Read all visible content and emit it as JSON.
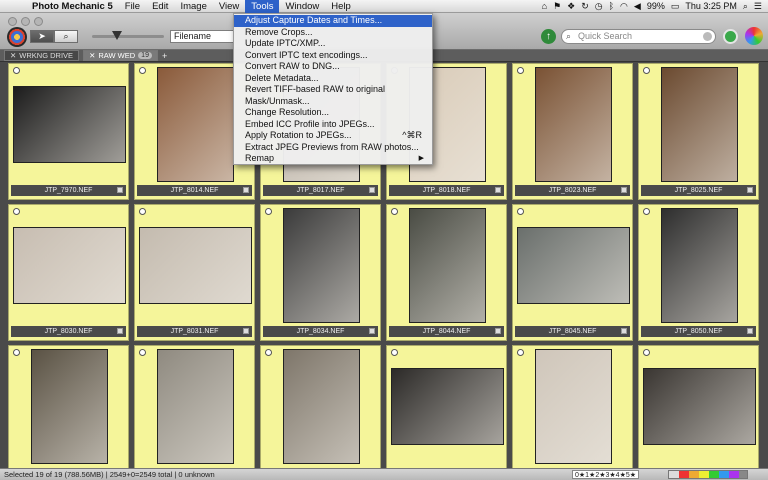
{
  "menubar": {
    "app": "Photo Mechanic 5",
    "items": [
      "File",
      "Edit",
      "Image",
      "View",
      "Tools",
      "Window",
      "Help"
    ],
    "battery": "99%",
    "clock": "Thu 3:25 PM"
  },
  "toolbar": {
    "sort_field": "Filename",
    "search_placeholder": "Quick Search"
  },
  "tabs": [
    {
      "label": "WRKNG DRIVE"
    },
    {
      "label": "RAW WED",
      "count": "19"
    }
  ],
  "tools_menu": {
    "items": [
      {
        "label": "Adjust Capture Dates and Times...",
        "highlight": true
      },
      {
        "label": "Remove Crops..."
      },
      {
        "label": "Update IPTC/XMP..."
      },
      {
        "label": "Convert IPTC text encodings..."
      },
      {
        "label": "Convert RAW to DNG..."
      },
      {
        "label": "Delete Metadata..."
      },
      {
        "label": "Revert TIFF-based RAW to original"
      },
      {
        "label": "Mask/Unmask..."
      },
      {
        "label": "Change Resolution..."
      },
      {
        "label": "Embed ICC Profile into JPEGs..."
      },
      {
        "label": "Apply Rotation to JPEGs...",
        "shortcut": "^⌘R"
      },
      {
        "label": "Extract JPEG Previews from RAW photos..."
      },
      {
        "label": "Remap",
        "submenu": true
      }
    ]
  },
  "thumbnails": [
    {
      "file": "JTP_7970.NEF",
      "color": "#1c1c1c"
    },
    {
      "file": "JTP_8014.NEF",
      "color": "#8a5a3a"
    },
    {
      "file": "JTP_8017.NEF",
      "color": "#b9b0a4"
    },
    {
      "file": "JTP_8018.NEF",
      "color": "#d9cbb8"
    },
    {
      "file": "JTP_8023.NEF",
      "color": "#7a5234"
    },
    {
      "file": "JTP_8025.NEF",
      "color": "#6b4a30"
    },
    {
      "file": "JTP_8030.NEF",
      "color": "#c7bdb1"
    },
    {
      "file": "JTP_8031.NEF",
      "color": "#c4bbaf"
    },
    {
      "file": "JTP_8034.NEF",
      "color": "#3b3b3b"
    },
    {
      "file": "JTP_8044.NEF",
      "color": "#4a4c44"
    },
    {
      "file": "JTP_8045.NEF",
      "color": "#6a6f6c"
    },
    {
      "file": "JTP_8050.NEF",
      "color": "#2e2e2e"
    },
    {
      "file": "",
      "color": "#5a5244"
    },
    {
      "file": "",
      "color": "#8f8a80"
    },
    {
      "file": "",
      "color": "#7e766a"
    },
    {
      "file": "",
      "color": "#2c2a28"
    },
    {
      "file": "",
      "color": "#cfc6ba"
    },
    {
      "file": "",
      "color": "#3a3632"
    }
  ],
  "status": {
    "text": "Selected 19 of 19 (788.56MB) | 2549+0=2549 total | 0 unknown",
    "rating": "0★1★2★3★4★5★"
  },
  "colors": {
    "cell_bg": "#f5f59a",
    "menu_highlight": "#2e62c9"
  }
}
